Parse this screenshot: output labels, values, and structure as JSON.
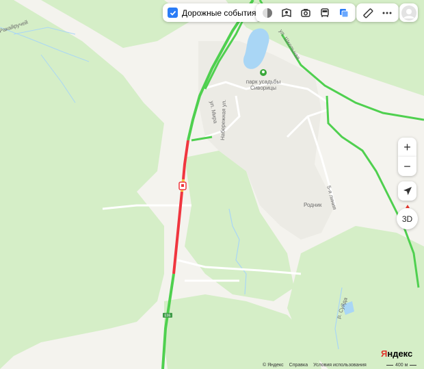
{
  "toolbar": {
    "traffic_label": "Дорожные события",
    "traffic_checked": true,
    "layer_icons": [
      "map-mode-icon",
      "panorama-icon",
      "camera-icon",
      "transit-icon",
      "layers-icon"
    ],
    "tool_icons": [
      "ruler-icon",
      "more-icon"
    ]
  },
  "controls": {
    "zoom_in": "+",
    "zoom_out": "−",
    "btn_3d": "3D"
  },
  "map": {
    "park_label_line1": "парк усадьбы",
    "park_label_line2": "Сиворицы",
    "street_mira": "ул. Мира",
    "street_naberezhnaya": "Набережная ул.",
    "street_shkolnaya": "ул. Школьная",
    "street_5_liniya": "5-я линия",
    "spring_label": "Родник",
    "river_suida": "р. Суйда",
    "stream_left": "Ракайручей",
    "road_shield": "E95"
  },
  "colors": {
    "forest": "#d5eec7",
    "open_land": "#f4f3ee",
    "water": "#a9d6f5",
    "traffic_free": "#4fd04f",
    "traffic_jam": "#f0363f",
    "traffic_slow": "#f7c840",
    "accent": "#2a7cf6",
    "logo_red": "#e0332a"
  },
  "footer": {
    "copyright": "© Яндекс",
    "help": "Справка",
    "terms": "Условия использования",
    "logo": "Яндекс",
    "logo_first_letter": "Я",
    "logo_rest": "ндекс",
    "scale": "400 м"
  }
}
